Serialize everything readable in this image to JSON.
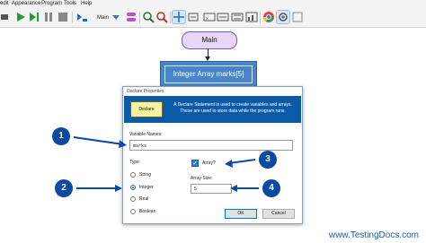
{
  "menubar": {
    "items": [
      "edit",
      "Appearance",
      "Program",
      "Tools",
      "Help"
    ]
  },
  "toolbar": {
    "zoom_label": "Main",
    "icons": [
      "run-icon",
      "step-icon",
      "pause-icon",
      "stop-icon",
      "debug-icon",
      "layout-icon",
      "zoom-in-icon",
      "zoom-out-icon",
      "select-icon",
      "var-watch-icon",
      "input-icon",
      "output-icon",
      "chart-icon",
      "console-icon",
      "chrome-icon",
      "settings-icon"
    ]
  },
  "flowchart": {
    "start_label": "Main",
    "declare_block_label": "Integer Array marks[5]"
  },
  "dialog": {
    "title": "Declare Properties",
    "badge_label": "Declare",
    "description": "A Declare Statement is used to create variables and arrays. These are used to store data while the program runs.",
    "variable_names_label": "Variable Names:",
    "variable_names_value": "marks",
    "type_label": "Type:",
    "types": [
      "String",
      "Integer",
      "Real",
      "Boolean"
    ],
    "selected_type": "Integer",
    "array_label": "Array?",
    "array_checked": true,
    "array_size_label": "Array Size:",
    "array_size_value": "5",
    "ok_label": "OK",
    "cancel_label": "Cancel"
  },
  "callouts": [
    "1",
    "2",
    "3",
    "4"
  ],
  "watermark": "www.TestingDocs.com",
  "colors": {
    "callout": "#0a4aa0",
    "dialog_header": "#0b5aa8",
    "declare_block": "#4a85c9",
    "start_terminal": "#e6d6f7"
  }
}
